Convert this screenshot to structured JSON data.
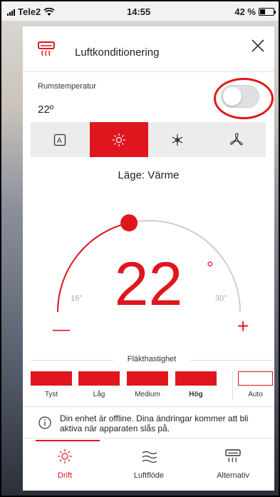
{
  "status_bar": {
    "carrier": "Tele2",
    "time": "14:55",
    "battery": "42 %"
  },
  "dialog": {
    "title": "Luftkonditionering",
    "icon": "air-conditioner-icon",
    "close_icon": "close-icon"
  },
  "room": {
    "label": "Rumstemperatur",
    "value": "22º",
    "toggle_on": false
  },
  "modes": [
    {
      "icon": "auto-mode-icon",
      "glyph": "A",
      "active": false
    },
    {
      "icon": "sun-heat-icon",
      "glyph": "☼",
      "active": true
    },
    {
      "icon": "snowflake-cool-icon",
      "glyph": "❄",
      "active": false
    },
    {
      "icon": "fan-icon",
      "glyph": "✤",
      "active": false
    }
  ],
  "mode_text": "Läge: Värme",
  "thermostat": {
    "temperature": "22",
    "degree": "°",
    "min": "16°",
    "max": "30°",
    "minus": "—",
    "plus": "+",
    "level": 0.43
  },
  "fan_speed": {
    "title": "Fläkthastighet",
    "options": [
      {
        "label": "Tyst",
        "filled": true
      },
      {
        "label": "Låg",
        "filled": true
      },
      {
        "label": "Medium",
        "filled": true
      },
      {
        "label": "Hög",
        "filled": true,
        "selected": true
      },
      {
        "label": "Auto",
        "filled": false
      }
    ]
  },
  "notice": {
    "text": "Din enhet är offline. Dina ändringar kommer att bli aktiva när apparaten slås på.",
    "icon": "info-icon"
  },
  "tabs": [
    {
      "label": "Drift",
      "icon": "sun-icon",
      "active": true
    },
    {
      "label": "Luftflöde",
      "icon": "airflow-icon",
      "active": false
    },
    {
      "label": "Alternativ",
      "icon": "air-conditioner-icon",
      "active": false
    }
  ],
  "colors": {
    "accent": "#e0161f",
    "highlight_ring": "#e01818"
  }
}
